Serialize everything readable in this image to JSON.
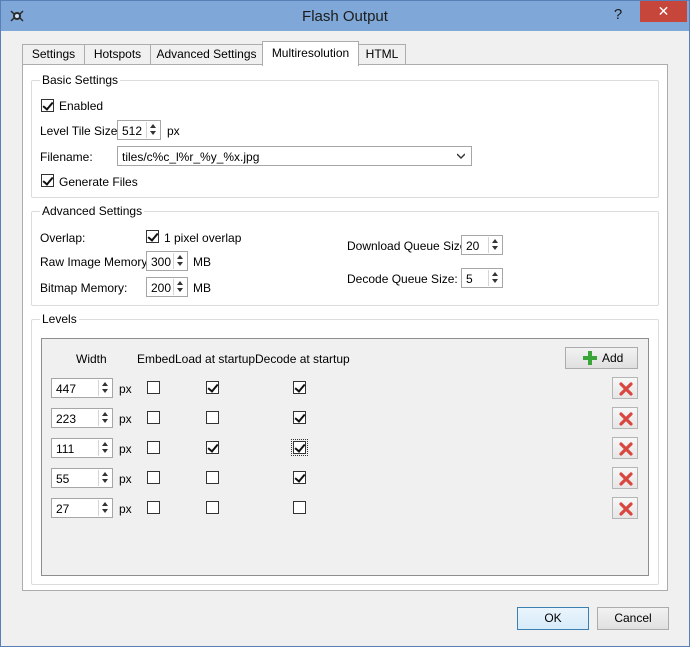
{
  "window": {
    "title": "Flash Output",
    "help_glyph": "?",
    "close_glyph": "✕"
  },
  "tabs": [
    {
      "label": "Settings"
    },
    {
      "label": "Hotspots"
    },
    {
      "label": "Advanced Settings"
    },
    {
      "label": "Multiresolution",
      "active": true
    },
    {
      "label": "HTML"
    }
  ],
  "basic": {
    "title": "Basic Settings",
    "enabled_label": "Enabled",
    "enabled": true,
    "tile_size_label": "Level Tile Size:",
    "tile_size": "512",
    "tile_size_unit": "px",
    "filename_label": "Filename:",
    "filename": "tiles/c%c_l%r_%y_%x.jpg",
    "generate_label": "Generate Files",
    "generate": true
  },
  "advanced": {
    "title": "Advanced Settings",
    "overlap_label": "Overlap:",
    "overlap_cb_label": "1 pixel overlap",
    "overlap": true,
    "raw_mem_label": "Raw Image Memory:",
    "raw_mem": "300",
    "raw_mem_unit": "MB",
    "bitmap_mem_label": "Bitmap Memory:",
    "bitmap_mem": "200",
    "bitmap_mem_unit": "MB",
    "download_label": "Download Queue Size:",
    "download": "20",
    "decode_label": "Decode Queue Size:",
    "decode": "5"
  },
  "levels": {
    "title": "Levels",
    "headers": {
      "width": "Width",
      "embed": "Embed",
      "load": "Load at startup",
      "decode": "Decode at startup"
    },
    "add_label": "Add",
    "unit": "px",
    "rows": [
      {
        "width": "447",
        "embed": false,
        "load": true,
        "decode": true
      },
      {
        "width": "223",
        "embed": false,
        "load": false,
        "decode": true
      },
      {
        "width": "111",
        "embed": false,
        "load": true,
        "decode": true
      },
      {
        "width": "55",
        "embed": false,
        "load": false,
        "decode": true
      },
      {
        "width": "27",
        "embed": false,
        "load": false,
        "decode": false
      }
    ]
  },
  "footer": {
    "ok_label": "OK",
    "cancel_label": "Cancel"
  },
  "colors": {
    "accent": "#3c7fb1",
    "titlebar": "#7fa8d8",
    "close": "#c7463c",
    "add_green": "#3aa63a",
    "delete_red": "#d9463f"
  }
}
